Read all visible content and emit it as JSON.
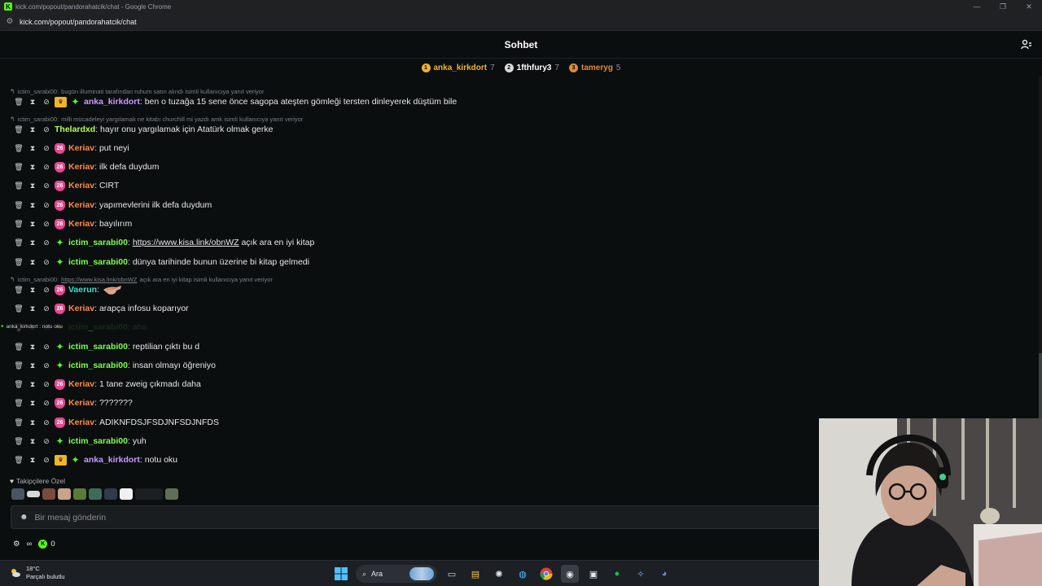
{
  "window": {
    "title": "kick.com/popout/pandorahatcik/chat - Google Chrome",
    "url": "kick.com/popout/pandorahatcik/chat"
  },
  "header": {
    "title": "Sohbet"
  },
  "leaderboard": [
    {
      "rank": "1",
      "name": "anka_kirkdort",
      "count": "7",
      "medal_color": "#f0b429",
      "name_color": "#f0b429"
    },
    {
      "rank": "2",
      "name": "1fthfury3",
      "count": "7",
      "medal_color": "#d7d9db",
      "name_color": "#ffffff"
    },
    {
      "rank": "3",
      "name": "tameryg",
      "count": "5",
      "medal_color": "#e08a3c",
      "name_color": "#e08a3c"
    }
  ],
  "replies": [
    {
      "author": "ictim_sarabi00:",
      "text": "bugün illuminati tarafından ruhum satın alındı isimli kullanıcıya yanıt veriyor"
    },
    {
      "author": "ictim_sarabi00:",
      "text": "milli mücadeleyi yargılamak ne kitabı churchill mi yazdı amk isimli kullanıcıya yanıt veriyor"
    },
    {
      "author": "ictim_sarabi00:",
      "link": "https://www.kisa.link/obnWZ",
      "text": "açık ara en iyi kitap isimli kullanıcıya yanıt veriyor"
    }
  ],
  "messages": [
    {
      "user": "anka_kirkdort",
      "text": "ben o tuzağa 15 sene önce sagopa ateşten gömleği tersten dinleyerek düştüm bile"
    },
    {
      "user": "Thelardxd",
      "text": "hayır onu yargılamak için Atatürk olmak gerke"
    },
    {
      "user": "Keriav",
      "text": "put neyi"
    },
    {
      "user": "Keriav",
      "text": "ilk defa duydum"
    },
    {
      "user": "Keriav",
      "text": "CIRT"
    },
    {
      "user": "Keriav",
      "text": "yapımevlerini ilk defa duydum"
    },
    {
      "user": "Keriav",
      "text": "bayılırım"
    },
    {
      "user": "ictim_sarabi00",
      "link": "https://www.kisa.link/obnWZ",
      "text": "açık ara en iyi kitap"
    },
    {
      "user": "ictim_sarabi00",
      "text": "dünya tarihinde bunun üzerine bi kitap gelmedi"
    },
    {
      "user": "Vaerun",
      "text": ""
    },
    {
      "user": "Keriav",
      "text": "arapça infosu koparıyor"
    },
    {
      "user": "ictim_sarabi00",
      "text": "aha"
    },
    {
      "user": "ictim_sarabi00",
      "text": "reptilian çıktı bu d"
    },
    {
      "user": "ictim_sarabi00",
      "text": "insan olmayı öğreniyo"
    },
    {
      "user": "Keriav",
      "text": "1 tane zweig çıkmadı daha"
    },
    {
      "user": "Keriav",
      "text": "???????"
    },
    {
      "user": "Keriav",
      "text": "ADIKNFDSJFSDJNFSDJNFDS"
    },
    {
      "user": "ictim_sarabi00",
      "text": "yuh"
    },
    {
      "user": "anka_kirkdort",
      "text": "notu oku"
    }
  ],
  "pinned_overlay": {
    "text": "anka_kirkdort : notu oku"
  },
  "footer": {
    "followers_label": "Takipçilere Özel",
    "input_placeholder": "Bir mesaj gönderin",
    "infinity": "∞",
    "points": "0"
  },
  "taskbar": {
    "temperature": "18°C",
    "weather": "Parçalı bulutlu",
    "search_label": "Ara"
  },
  "colors": {
    "kick_green": "#53fc18",
    "anka": "#c79bff",
    "thelard": "#b5ff4a",
    "keriav": "#ff8a4a",
    "ictim": "#7cff4a",
    "vaerun": "#38e0c8"
  }
}
